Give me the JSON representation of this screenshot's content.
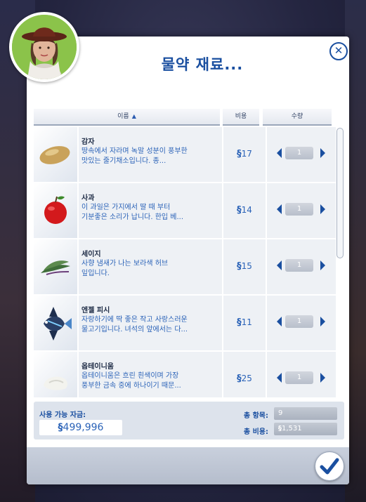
{
  "dialog": {
    "title": "물약 재료...",
    "close_icon": "close-icon",
    "confirm_icon": "checkmark-icon"
  },
  "table": {
    "columns": {
      "name": "이름",
      "cost": "비용",
      "quantity": "수량"
    },
    "sort_indicator": "▲",
    "items": [
      {
        "name": "감자",
        "desc_line1": "땅속에서 자라며 녹말 성분이 풍부한",
        "desc_line2": "맛있는 줄기채소입니다. 종...",
        "currency": "§",
        "price": "17",
        "quantity": "1",
        "icon": "potato"
      },
      {
        "name": "사과",
        "desc_line1": "이 과일은 가지에서 딸 때 부터",
        "desc_line2": "기분좋은 소리가 납니다. 한입 베...",
        "currency": "§",
        "price": "14",
        "quantity": "1",
        "icon": "apple"
      },
      {
        "name": "세이지",
        "desc_line1": "사향 냄새가 나는 보라색 허브",
        "desc_line2": "잎입니다.",
        "currency": "§",
        "price": "15",
        "quantity": "1",
        "icon": "sage"
      },
      {
        "name": "엔젤 피시",
        "desc_line1": "자랑하기에 딱 좋은 작고 사랑스러운",
        "desc_line2": "물고기입니다. 녀석의 앞에서는 다...",
        "currency": "§",
        "price": "11",
        "quantity": "1",
        "icon": "angelfish"
      },
      {
        "name": "옵테이니움",
        "desc_line1": "옵테이니움은 흐린 흰색이며 가장",
        "desc_line2": "풍부한 금속 중에 하나이기 때문...",
        "currency": "§",
        "price": "25",
        "quantity": "1",
        "icon": "metal-ore"
      }
    ]
  },
  "summary": {
    "funds_label": "사용 가능 자금:",
    "funds_currency": "§",
    "funds_value": "499,996",
    "total_items_label": "총 항목:",
    "total_items_value": "9",
    "total_cost_label": "총 비용:",
    "total_cost_currency": "§",
    "total_cost_value": "1,531"
  },
  "colors": {
    "accent": "#1a4fa0",
    "text_blue": "#2b63b8",
    "row_bg": "#eef1f5"
  }
}
